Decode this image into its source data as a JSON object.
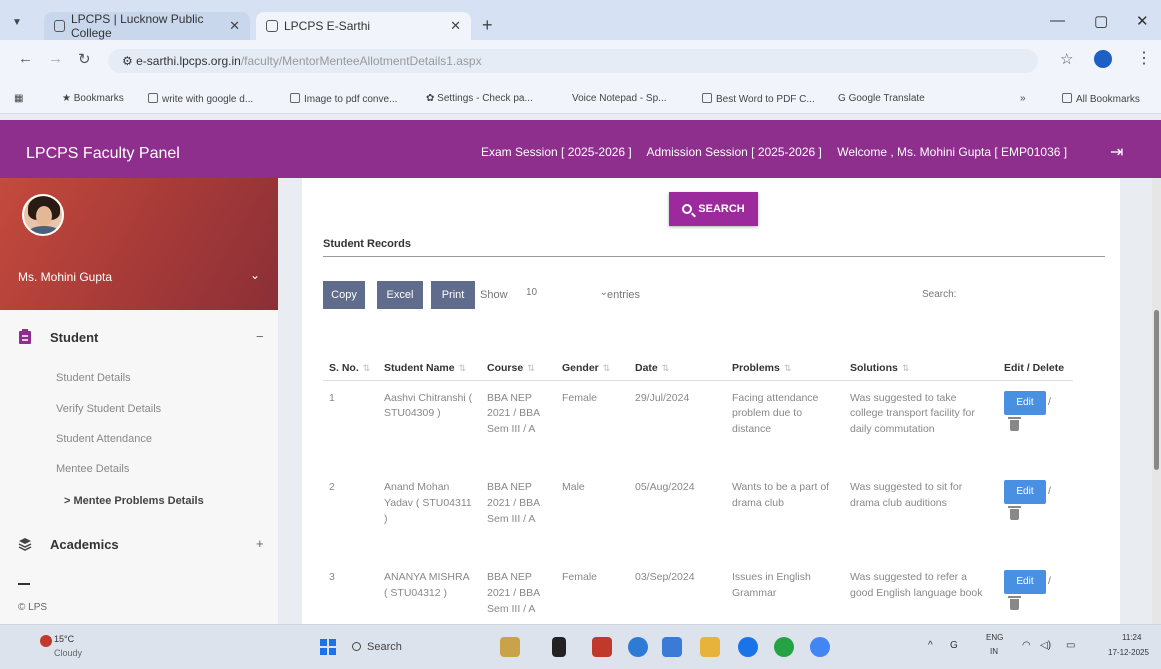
{
  "browser": {
    "tabs": [
      {
        "label": "LPCPS | Lucknow Public College"
      },
      {
        "label": "LPCPS E-Sarthi"
      }
    ],
    "url_host": "e-sarthi.lpcps.org.in",
    "url_path": "/faculty/MentorMenteeAllotmentDetails1.aspx",
    "bookmarks": [
      {
        "label": "Bookmarks",
        "icon": "star-icon"
      },
      {
        "label": "write with google d...",
        "icon": "page-icon"
      },
      {
        "label": "Image to pdf conve...",
        "icon": "page-icon"
      },
      {
        "label": "Settings - Check pa...",
        "icon": "gear-icon"
      },
      {
        "label": "Voice Notepad - Sp...",
        "icon": "page-icon"
      },
      {
        "label": "Best Word to PDF C...",
        "icon": "page-icon"
      },
      {
        "label": "Google Translate",
        "icon": "translate-icon"
      },
      {
        "label": "All Bookmarks",
        "icon": "folder-icon"
      }
    ]
  },
  "header": {
    "title": "LPCPS Faculty Panel",
    "exam_session": "Exam Session [ 2025-2026 ]",
    "admission_session": "Admission Session [ 2025-2026 ]",
    "welcome": "Welcome , Ms. Mohini Gupta [ EMP01036 ]"
  },
  "sidebar": {
    "user_name": "Ms. Mohini Gupta",
    "menu": [
      {
        "label": "Student",
        "sign": "−"
      },
      {
        "label": "Academics",
        "sign": "+"
      }
    ],
    "submenu": [
      {
        "label": "Student Details"
      },
      {
        "label": "Verify Student Details"
      },
      {
        "label": "Student Attendance"
      },
      {
        "label": "Mentee Details"
      },
      {
        "label": "> Mentee Problems Details"
      }
    ],
    "footer": "© LPS"
  },
  "main": {
    "search_label": "SEARCH",
    "section_title": "Student Records",
    "buttons": {
      "copy": "Copy",
      "excel": "Excel",
      "print": "Print"
    },
    "show_label": "Show",
    "show_value": "10",
    "entries_label": "entries",
    "search_field_label": "Search:",
    "table": {
      "headers": [
        "S. No.",
        "Student Name",
        "Course",
        "Gender",
        "Date",
        "Problems",
        "Solutions",
        "Edit / Delete"
      ],
      "rows": [
        {
          "sno": "1",
          "name": "Aashvi Chitranshi ( STU04309 )",
          "course": "BBA NEP 2021 / BBA Sem III / A",
          "gender": "Female",
          "date": "29/Jul/2024",
          "problem": "Facing attendance problem due to distance",
          "solution": "Was suggested to take college transport facility for daily commutation"
        },
        {
          "sno": "2",
          "name": "Anand Mohan Yadav ( STU04311 )",
          "course": "BBA NEP 2021 / BBA Sem III / A",
          "gender": "Male",
          "date": "05/Aug/2024",
          "problem": "Wants to be a part of drama club",
          "solution": "Was suggested to sit for drama club auditions"
        },
        {
          "sno": "3",
          "name": "ANANYA MISHRA ( STU04312 )",
          "course": "BBA NEP 2021 / BBA Sem III / A",
          "gender": "Female",
          "date": "03/Sep/2024",
          "problem": "Issues in English Grammar",
          "solution": "Was suggested to refer a good English language book"
        }
      ],
      "edit_label": "Edit"
    }
  },
  "taskbar": {
    "temperature": "15°C",
    "weather": "Cloudy",
    "search": "Search",
    "lang_top": "ENG",
    "lang_bottom": "IN",
    "time": "11:24",
    "date": "17-12-2025"
  },
  "colors": {
    "header": "#8e2f8e",
    "search_button": "#9c2a9c",
    "table_buttons": "#5f6c8c",
    "edit_button": "#4a90e2"
  }
}
